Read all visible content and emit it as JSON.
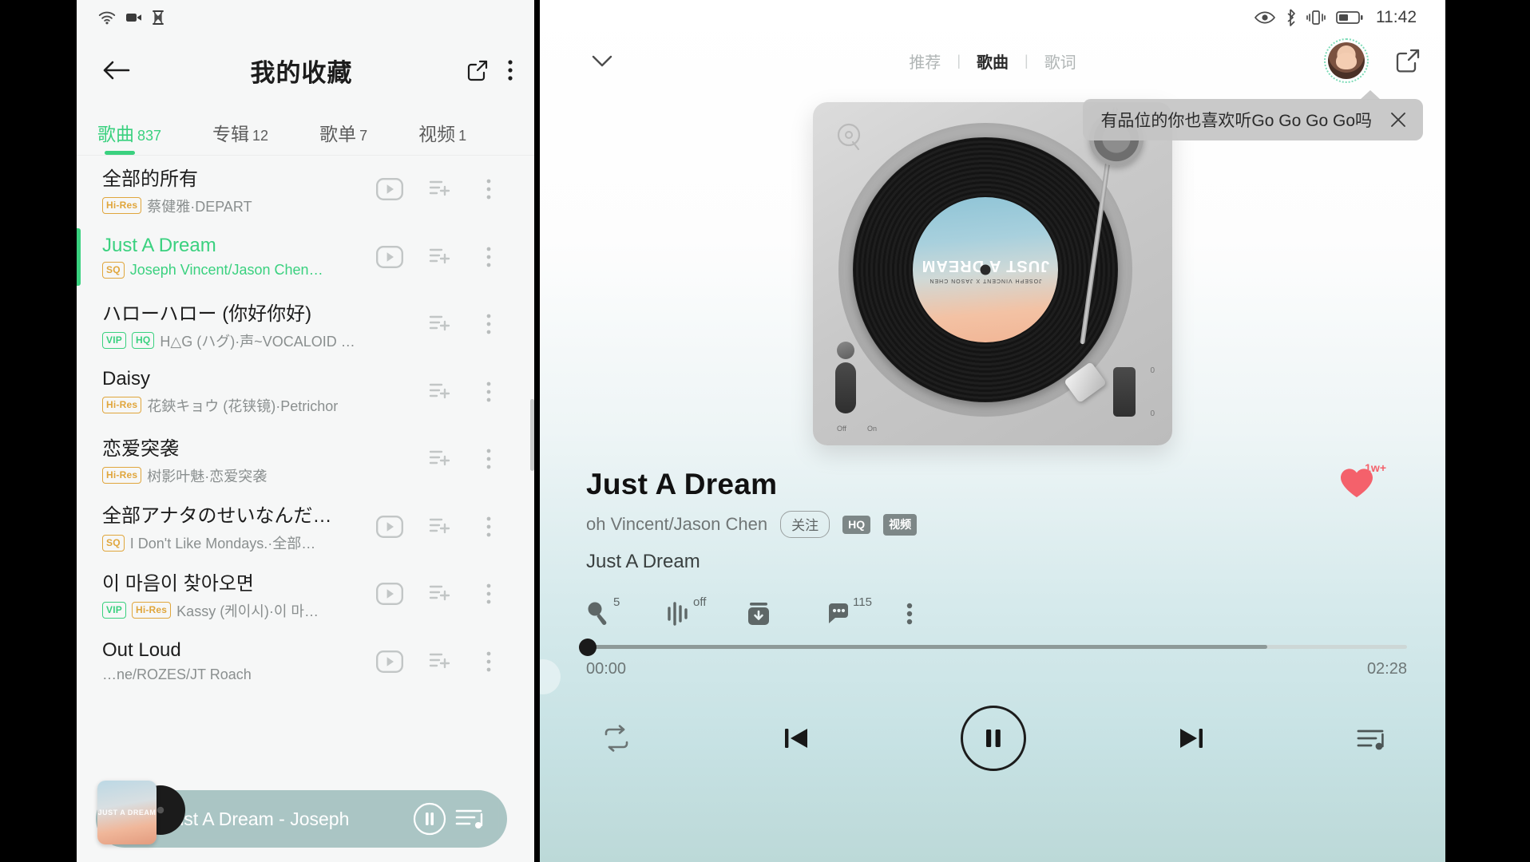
{
  "left": {
    "status_icons": [
      "wifi-icon",
      "video-recording-icon",
      "hourglass-icon"
    ],
    "appbar": {
      "back_icon": "back-arrow-icon",
      "title": "我的收藏",
      "share_icon": "share-icon",
      "more_icon": "more-vertical-icon"
    },
    "tabs": [
      {
        "name": "歌曲",
        "count": "837",
        "active": true
      },
      {
        "name": "专辑",
        "count": "12",
        "active": false
      },
      {
        "name": "歌单",
        "count": "7",
        "active": false
      },
      {
        "name": "视频",
        "count": "1",
        "active": false
      }
    ],
    "songs": [
      {
        "title": "全部的所有",
        "tags": [
          {
            "text": "Hi-Res",
            "cls": "hires"
          }
        ],
        "artist": "蔡健雅·DEPART",
        "has_mv": true,
        "active": false
      },
      {
        "title": "Just A Dream",
        "tags": [
          {
            "text": "SQ",
            "cls": "sq"
          }
        ],
        "artist": "Joseph Vincent/Jason Chen…",
        "has_mv": true,
        "active": true
      },
      {
        "title": "ハローハロー (你好你好)",
        "tags": [
          {
            "text": "VIP",
            "cls": "vip"
          },
          {
            "text": "HQ",
            "cls": "hq"
          }
        ],
        "artist": "H△G (ハグ)·声~VOCALOID Cove…",
        "has_mv": false,
        "active": false
      },
      {
        "title": "Daisy",
        "tags": [
          {
            "text": "Hi-Res",
            "cls": "hires"
          }
        ],
        "artist": "花鋏キョウ (花铗镜)·Petrichor",
        "has_mv": false,
        "active": false
      },
      {
        "title": "恋爱突袭",
        "tags": [
          {
            "text": "Hi-Res",
            "cls": "hires"
          }
        ],
        "artist": "树影叶魅·恋爱突袭",
        "has_mv": false,
        "active": false
      },
      {
        "title": "全部アナタのせいなんだ…",
        "tags": [
          {
            "text": "SQ",
            "cls": "sq"
          }
        ],
        "artist": "I Don't Like Mondays.·全部…",
        "has_mv": true,
        "active": false
      },
      {
        "title": "이 마음이 찾아오면",
        "tags": [
          {
            "text": "VIP",
            "cls": "vip"
          },
          {
            "text": "Hi-Res",
            "cls": "hires"
          }
        ],
        "artist": "Kassy (케이시)·이 마…",
        "has_mv": true,
        "active": false
      },
      {
        "title": "Out Loud",
        "tags": [],
        "artist": "…ne/ROZES/JT Roach",
        "has_mv": true,
        "active": false
      }
    ],
    "row_icons": {
      "mv": "mv-play-icon",
      "add": "add-to-playlist-icon",
      "more": "more-vertical-icon"
    },
    "mini_player": {
      "cover_text": "JUST A DREAM",
      "title": "Just A Dream - Joseph",
      "play_icon": "pause-icon",
      "queue_icon": "playlist-queue-icon"
    }
  },
  "right": {
    "status": {
      "icons": [
        "eye-comfort-icon",
        "bluetooth-icon",
        "vibrate-icon",
        "battery-icon"
      ],
      "time": "11:42"
    },
    "topbar": {
      "collapse_icon": "chevron-down-icon",
      "tabs": [
        {
          "label": "推荐",
          "active": false
        },
        {
          "label": "歌曲",
          "active": true
        },
        {
          "label": "歌词",
          "active": false
        }
      ],
      "separator": "|",
      "avatar": "user-avatar",
      "share_icon": "share-icon"
    },
    "tooltip": {
      "text": "有品位的你也喜欢听Go Go Go Go吗",
      "close_icon": "close-icon"
    },
    "turntable": {
      "brand_logo": "q-music-logo",
      "label_title": "JUST A DREAM",
      "label_sub": "JOSEPH VINCENT X JASON CHEN",
      "switch_off": "Off",
      "switch_on": "On",
      "slider_marks": [
        "0",
        "0"
      ]
    },
    "meta": {
      "title": "Just A Dream",
      "artist": "oh Vincent/Jason Chen",
      "follow_label": "关注",
      "quality_chip": "HQ",
      "video_chip": "视频",
      "subtitle": "Just A Dream",
      "like_icon": "heart-filled-icon",
      "like_count": "1w+"
    },
    "actions": [
      {
        "icon": "microphone-icon",
        "badge": "5"
      },
      {
        "icon": "equalizer-icon",
        "badge": "off"
      },
      {
        "icon": "download-icon",
        "badge": ""
      },
      {
        "icon": "comment-icon",
        "badge": "115"
      },
      {
        "icon": "more-vertical-icon",
        "badge": ""
      }
    ],
    "progress": {
      "current_time": "00:00",
      "total_time": "02:28",
      "value_percent": 0
    },
    "controls": [
      {
        "icon": "repeat-icon",
        "name": "repeat-button"
      },
      {
        "icon": "previous-icon",
        "name": "previous-button"
      },
      {
        "icon": "pause-icon",
        "name": "play-pause-button"
      },
      {
        "icon": "next-icon",
        "name": "next-button"
      },
      {
        "icon": "playlist-queue-icon",
        "name": "queue-button"
      }
    ]
  },
  "colors": {
    "accent_green": "#3ad17f",
    "tag_gold": "#e0a63c",
    "heart_red": "#f4616b",
    "player_bg": "#c7e2e4"
  }
}
